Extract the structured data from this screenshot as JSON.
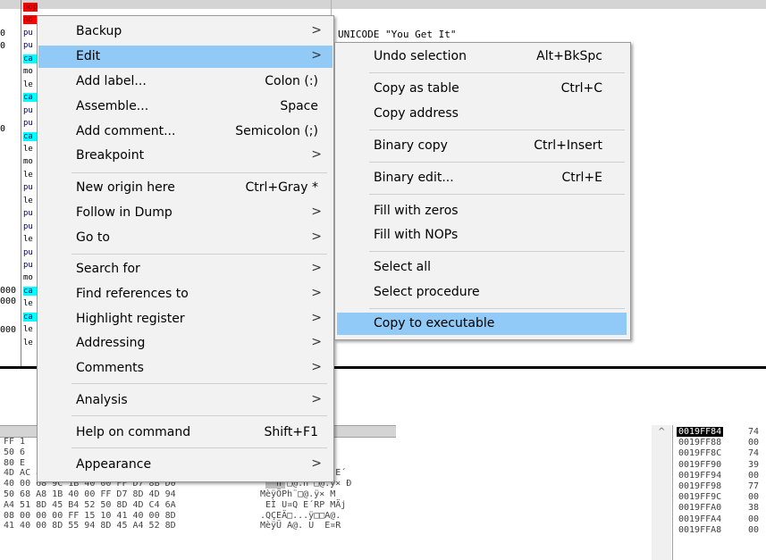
{
  "colors": {
    "menu_bg": "#f2f2f2",
    "menu_highlight": "#91c9f7",
    "call_highlight": "#00ffff",
    "nop_highlight": "#ff0000",
    "disasm_text": "#000080"
  },
  "background": {
    "addr_fragments": [
      "0",
      "0",
      "0",
      "000",
      "000",
      "000"
    ],
    "disasm_fragments": [
      {
        "text": "nop",
        "kind": "nop"
      },
      {
        "text": "no",
        "kind": "nop"
      },
      {
        "text": "pu",
        "kind": "push"
      },
      {
        "text": "pu",
        "kind": "push"
      },
      {
        "text": "ca",
        "kind": "call"
      },
      {
        "text": "mo",
        "kind": "bk"
      },
      {
        "text": "le",
        "kind": "bk"
      },
      {
        "text": "ca",
        "kind": "call"
      },
      {
        "text": "pu",
        "kind": "push"
      },
      {
        "text": "pu",
        "kind": "push"
      },
      {
        "text": "ca",
        "kind": "call"
      },
      {
        "text": "le",
        "kind": "bk"
      },
      {
        "text": "mo",
        "kind": "bk"
      },
      {
        "text": "le",
        "kind": "bk"
      },
      {
        "text": "pu",
        "kind": "push"
      },
      {
        "text": "le",
        "kind": "bk"
      },
      {
        "text": "pu",
        "kind": "push"
      },
      {
        "text": "pu",
        "kind": "push"
      },
      {
        "text": "le",
        "kind": "bk"
      },
      {
        "text": "pu",
        "kind": "push"
      },
      {
        "text": "pu",
        "kind": "push"
      },
      {
        "text": "mo",
        "kind": "bk"
      },
      {
        "text": "ca",
        "kind": "call"
      },
      {
        "text": "le",
        "kind": "bk"
      },
      {
        "text": "ca",
        "kind": "call"
      },
      {
        "text": "le",
        "kind": "bk"
      },
      {
        "text": "le",
        "kind": "bk"
      }
    ],
    "comment": "UNICODE \"You Get It\"",
    "dump_hex": [
      "FF 1",
      "50 6",
      "80 E",
      "4D AC 89 45 A4 89 4D BC 89 45 B4",
      "40 00 68 9C 1B 40 00 FF D7 8B D0",
      "50 68 A8 1B 40 00 FF D7 8D 4D 94",
      "A4 51 8D 45 B4 52 50 8D 4D C4 6A",
      "08 00 00 00 FF 15 10 41 40 00 8D",
      "41 40 00 8D 55 94 8D 45 A4 52 8D"
    ],
    "dump_ascii": [
      ". ÄU U",
      "ð@@. Ä",
      ". M f",
      "ö E  M¬ E¤ M¼ E´",
      "   h □@.h □@.ÿ× Ð",
      "MèÿÖPh¨□@.ÿ× M",
      " EÌ U¤Q E´RP MÄj",
      ".QÇEÄ□...ÿ□□A@.",
      "MèÿÜ A@. U  E¤R"
    ],
    "stack_addrs": [
      "0019FF84",
      "0019FF88",
      "0019FF8C",
      "0019FF90",
      "0019FF94",
      "0019FF98",
      "0019FF9C",
      "0019FFA0",
      "0019FFA4",
      "0019FFA8"
    ],
    "stack_vals": [
      "74",
      "00",
      "74",
      "39",
      "00",
      "77",
      "00",
      "38",
      "00",
      "00"
    ],
    "scroll_arrow": "^"
  },
  "main_menu": {
    "items": [
      {
        "label": "Backup",
        "shortcut": "",
        "submenu": true
      },
      {
        "label": "Edit",
        "shortcut": "",
        "submenu": true,
        "highlighted": true
      },
      {
        "label": "Add label...",
        "shortcut": "Colon (:)",
        "submenu": false
      },
      {
        "label": "Assemble...",
        "shortcut": "Space",
        "submenu": false
      },
      {
        "label": "Add comment...",
        "shortcut": "Semicolon (;)",
        "submenu": false
      },
      {
        "label": "Breakpoint",
        "shortcut": "",
        "submenu": true
      },
      {
        "label": "New origin here",
        "shortcut": "Ctrl+Gray *",
        "submenu": false
      },
      {
        "label": "Follow in Dump",
        "shortcut": "",
        "submenu": true
      },
      {
        "label": "Go to",
        "shortcut": "",
        "submenu": true
      },
      {
        "label": "Search for",
        "shortcut": "",
        "submenu": true
      },
      {
        "label": "Find references to",
        "shortcut": "",
        "submenu": true
      },
      {
        "label": "Highlight register",
        "shortcut": "",
        "submenu": true
      },
      {
        "label": "Addressing",
        "shortcut": "",
        "submenu": true
      },
      {
        "label": "Comments",
        "shortcut": "",
        "submenu": true
      },
      {
        "label": "Analysis",
        "shortcut": "",
        "submenu": true
      },
      {
        "label": "Help on command",
        "shortcut": "Shift+F1",
        "submenu": false
      },
      {
        "label": "Appearance",
        "shortcut": "",
        "submenu": true
      }
    ],
    "submenu_arrow": ">"
  },
  "edit_submenu": {
    "items": [
      {
        "label": "Undo selection",
        "shortcut": "Alt+BkSpc"
      },
      {
        "label": "Copy as table",
        "shortcut": "Ctrl+C"
      },
      {
        "label": "Copy address",
        "shortcut": ""
      },
      {
        "label": "Binary copy",
        "shortcut": "Ctrl+Insert"
      },
      {
        "label": "Binary edit...",
        "shortcut": "Ctrl+E"
      },
      {
        "label": "Fill with zeros",
        "shortcut": ""
      },
      {
        "label": "Fill with NOPs",
        "shortcut": ""
      },
      {
        "label": "Select all",
        "shortcut": ""
      },
      {
        "label": "Select procedure",
        "shortcut": ""
      },
      {
        "label": "Copy to executable",
        "shortcut": "",
        "highlighted": true
      }
    ]
  }
}
